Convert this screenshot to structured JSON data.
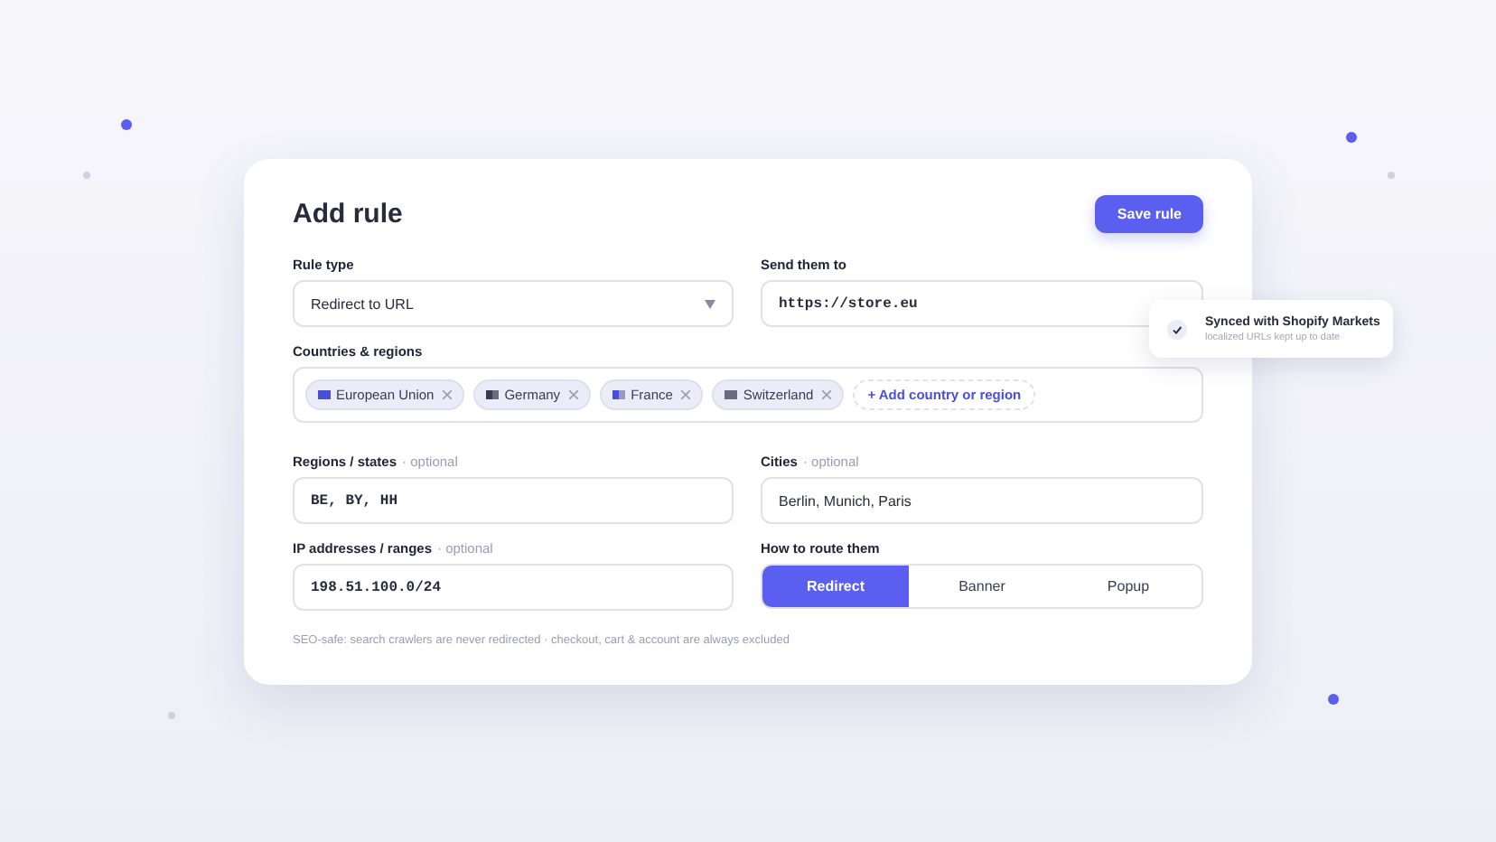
{
  "card": {
    "title": "Add rule",
    "save_button": "Save rule",
    "rule_type": {
      "label": "Rule type",
      "value": "Redirect to URL"
    },
    "send_to": {
      "label": "Send them to",
      "value": "https://store.eu"
    },
    "countries": {
      "label": "Countries & regions",
      "tags": [
        {
          "label": "European Union"
        },
        {
          "label": "Germany"
        },
        {
          "label": "France"
        },
        {
          "label": "Switzerland"
        }
      ],
      "add_label": "+ Add country or region"
    },
    "regions": {
      "label": "Regions / states",
      "hint": "· optional",
      "value": "BE, BY, HH"
    },
    "cities": {
      "label": "Cities",
      "hint": "· optional",
      "value": "Berlin, Munich, Paris"
    },
    "ip": {
      "label": "IP addresses / ranges",
      "hint": "· optional",
      "value": "198.51.100.0/24"
    },
    "route": {
      "label": "How to route them",
      "options": [
        {
          "label": "Redirect",
          "selected": true
        },
        {
          "label": "Banner",
          "selected": false
        },
        {
          "label": "Popup",
          "selected": false
        }
      ]
    },
    "footnote": "SEO-safe: search crawlers are never redirected · checkout, cart & account are always excluded"
  },
  "toast": {
    "title": "Synced with Shopify Markets",
    "subtitle": "localized URLs kept up to date"
  }
}
